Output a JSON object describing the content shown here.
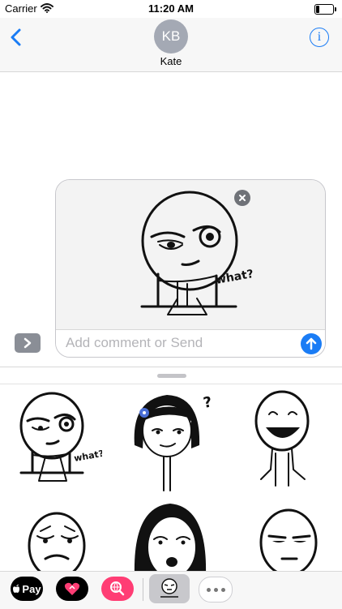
{
  "status_bar": {
    "carrier": "Carrier",
    "time": "11:20 AM"
  },
  "conversation": {
    "contact_initials": "KB",
    "contact_name": "Kate"
  },
  "composer": {
    "placeholder": "Add comment or Send",
    "selected_sticker": {
      "icon": "what-face-sticker",
      "caption": "what?"
    }
  },
  "sticker_drawer": {
    "stickers": [
      {
        "icon": "what-face-sticker",
        "caption": "what?"
      },
      {
        "icon": "confused-girl-sticker",
        "caption": "?"
      },
      {
        "icon": "smiling-man-sticker"
      },
      {
        "icon": "worried-face-sticker"
      },
      {
        "icon": "surprised-girl-sticker"
      },
      {
        "icon": "unimpressed-face-sticker"
      }
    ]
  },
  "app_bar": {
    "apple_pay_label": "Pay",
    "apps": [
      "apple-pay-icon",
      "heart-app-icon",
      "globe-search-icon",
      "meme-sticker-app-icon",
      "more-icon"
    ]
  },
  "colors": {
    "accent": "#1a7cf5",
    "avatar": "#a4a9b4",
    "search_app": "#ff3d74"
  }
}
